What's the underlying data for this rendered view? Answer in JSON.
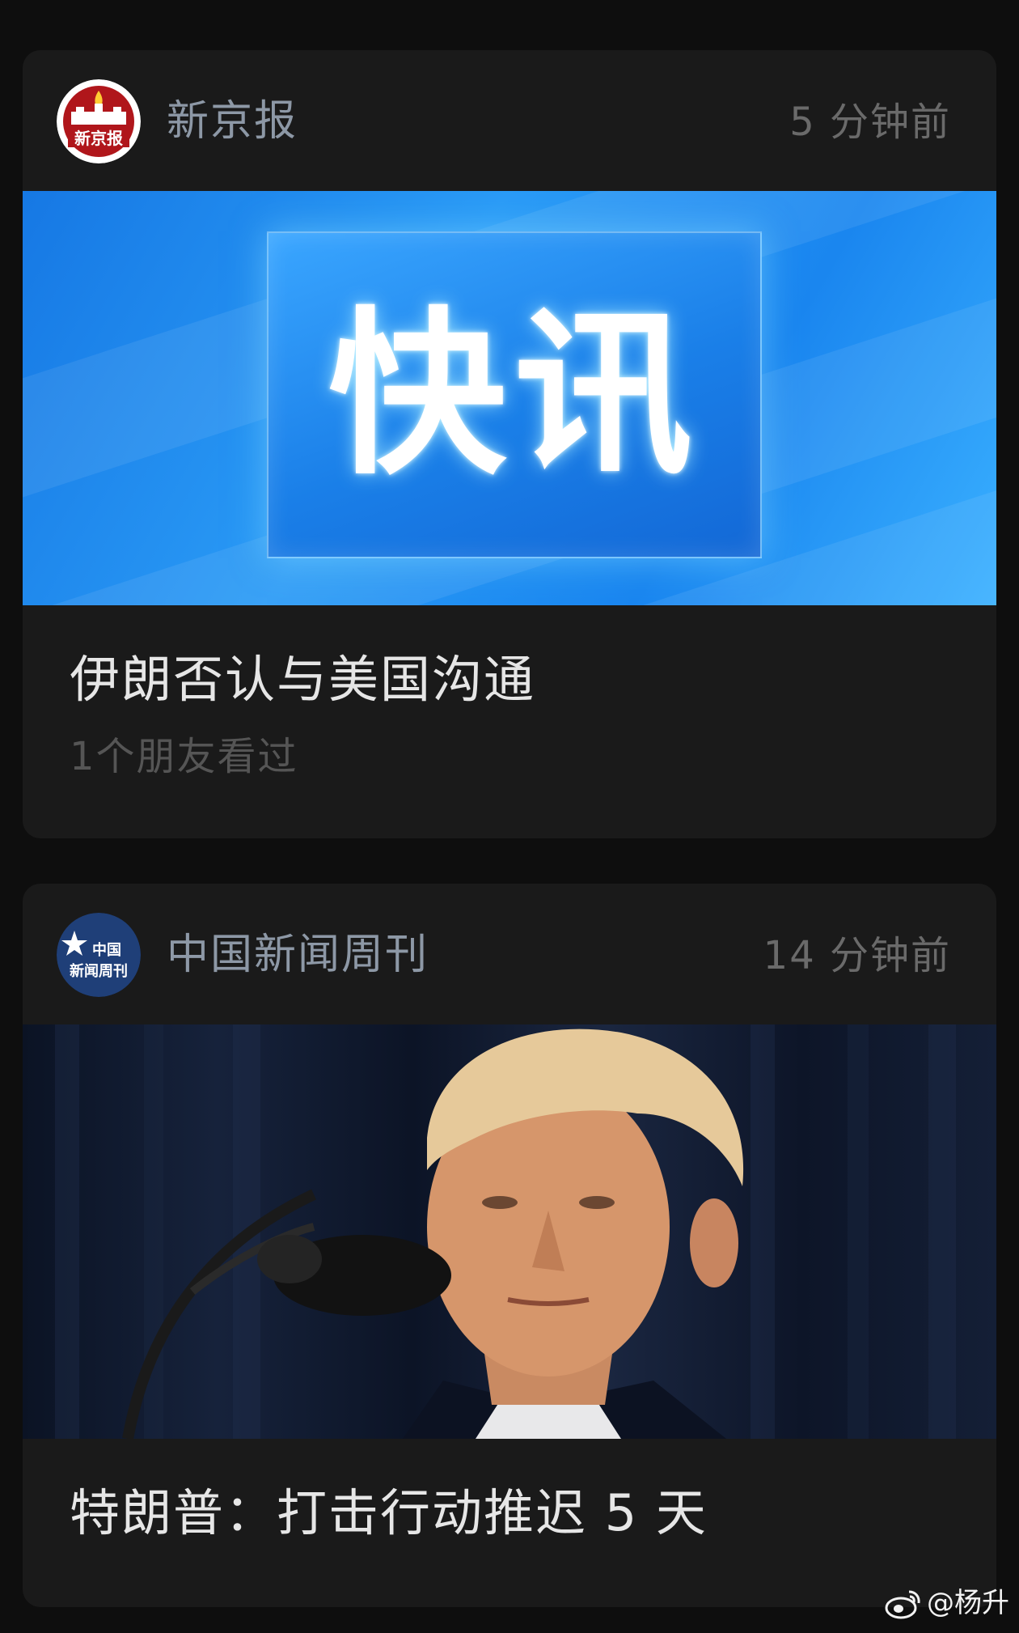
{
  "feed": {
    "cards": [
      {
        "source": "新京报",
        "logo_text": "新京报",
        "time": "5 分钟前",
        "image_text": "快讯",
        "headline": "伊朗否认与美国沟通",
        "meta": "1个朋友看过"
      },
      {
        "source": "中国新闻周刊",
        "logo_text_line1": "中国",
        "logo_text_line2": "新闻周刊",
        "time": "14 分钟前",
        "headline": "特朗普：打击行动推迟 5 天"
      }
    ]
  },
  "watermark": {
    "text": "@杨升"
  },
  "colors": {
    "background": "#0e0e0e",
    "card": "#1a1a1a",
    "source_name": "#8d98a6",
    "time": "#6a6a6a",
    "headline": "#e6e6e6",
    "meta": "#555555",
    "xinjingbao_red": "#b0161b",
    "newsweek_blue": "#1f3f78",
    "flash_blue": "#1a86ef"
  },
  "icons": {
    "watermark": "weibo-icon"
  }
}
